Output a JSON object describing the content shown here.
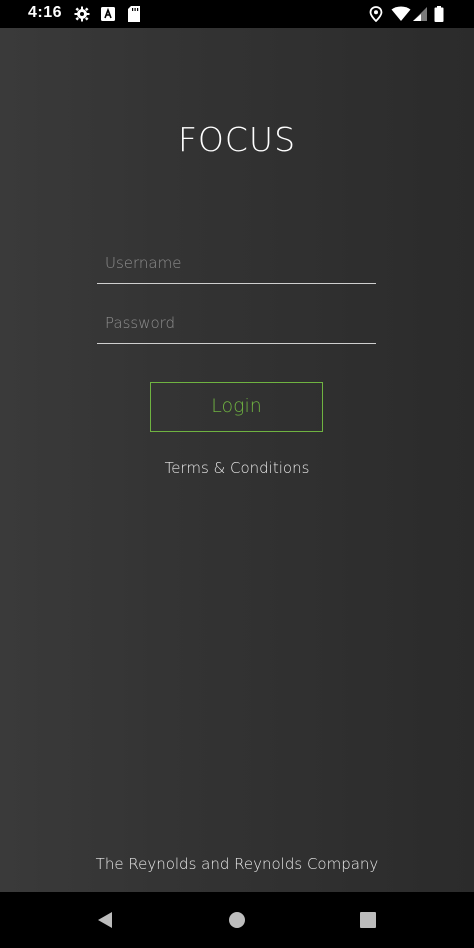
{
  "status_bar": {
    "time": "4:16",
    "icons": [
      "gear-icon",
      "a-letter-icon",
      "sd-card-icon",
      "location-icon",
      "wifi-icon",
      "signal-icon",
      "battery-icon"
    ]
  },
  "app": {
    "title": "FOCUS",
    "username": {
      "placeholder": "Username",
      "value": ""
    },
    "password": {
      "placeholder": "Password",
      "value": ""
    },
    "login_label": "Login",
    "terms_label": "Terms & Conditions",
    "footer": "The Reynolds and Reynolds Company"
  },
  "colors": {
    "accent": "#6fb341",
    "background": "#2d2d2d",
    "text": "#e8e8e8"
  },
  "nav_bar": {
    "buttons": [
      "back-icon",
      "home-icon",
      "recents-icon"
    ]
  }
}
